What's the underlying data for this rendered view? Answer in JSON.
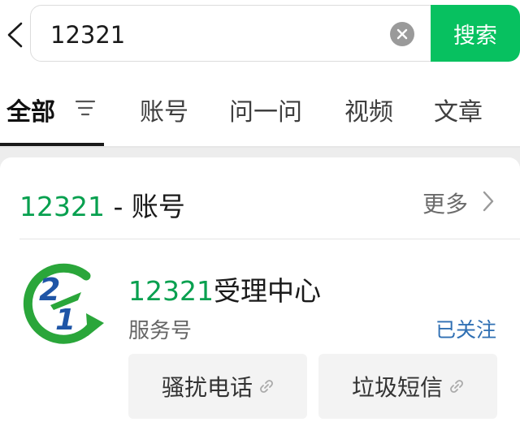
{
  "search": {
    "query": "12321",
    "button_label": "搜索"
  },
  "tabs": [
    {
      "label": "全部",
      "active": true
    },
    {
      "label": "账号",
      "active": false
    },
    {
      "label": "问一问",
      "active": false
    },
    {
      "label": "视频",
      "active": false
    },
    {
      "label": "文章",
      "active": false
    }
  ],
  "section": {
    "keyword": "12321",
    "title_suffix": " - 账号",
    "more_label": "更多"
  },
  "account": {
    "name_highlight": "12321",
    "name_rest": "受理中心",
    "type": "服务号",
    "follow_status": "已关注",
    "menu_items": [
      "骚扰电话",
      "垃圾短信"
    ]
  },
  "colors": {
    "accent_green": "#07c160",
    "highlight_green": "#07a04f",
    "followed_blue": "#2f6fb3"
  },
  "icons": [
    "back-arrow-icon",
    "clear-icon",
    "filter-icon",
    "chevron-right-icon",
    "link-icon"
  ]
}
